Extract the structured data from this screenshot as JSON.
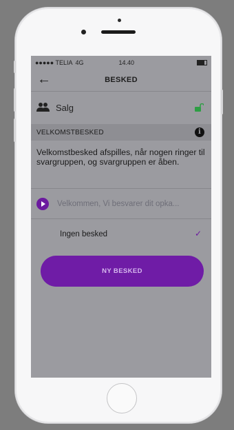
{
  "status_bar": {
    "carrier": "●●●●● TELIA",
    "network": "4G",
    "time": "14.40"
  },
  "nav": {
    "title": "BESKED",
    "back_icon": "arrow-left-icon"
  },
  "group": {
    "icon": "group-icon",
    "name": "Salg",
    "lock_icon": "unlocked-padlock-icon"
  },
  "section": {
    "header": "VELKOMSTBESKED",
    "info_icon": "info-icon"
  },
  "description": "Velkomstbesked afspilles, når nogen ringer til svargruppen, og svargruppen er åben.",
  "message_option": {
    "icon": "play-icon",
    "text": "Velkommen, Vi besvarer dit opka..."
  },
  "no_message_option": {
    "label": "Ingen besked",
    "selected": true
  },
  "button": {
    "label": "NY BESKED"
  },
  "colors": {
    "accent": "#6f1ca6",
    "lock_green": "#2e9e44",
    "screen_bg": "#9b9ba0"
  }
}
